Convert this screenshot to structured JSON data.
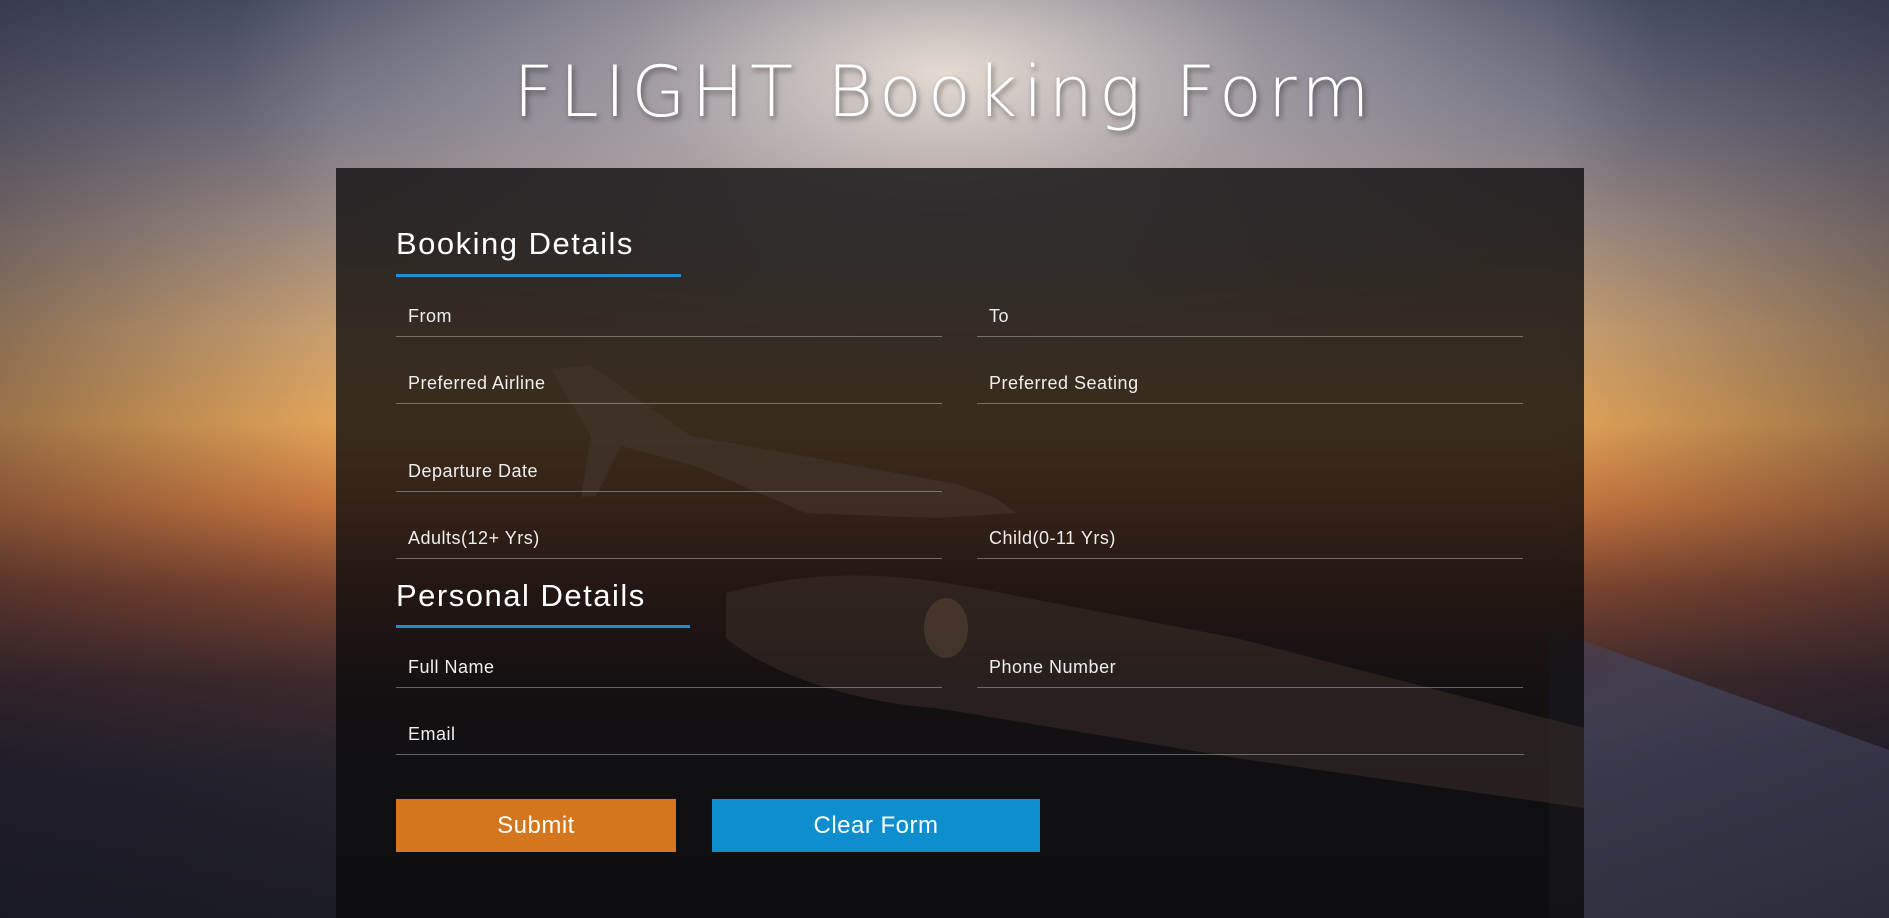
{
  "page": {
    "title": "FLIGHT Booking Form"
  },
  "booking": {
    "heading": "Booking Details",
    "from_placeholder": "From",
    "to_placeholder": "To",
    "airline_placeholder": "Preferred Airline",
    "seating_placeholder": "Preferred Seating",
    "departure_placeholder": "Departure Date",
    "adults_placeholder": "Adults(12+ Yrs)",
    "child_placeholder": "Child(0-11 Yrs)"
  },
  "personal": {
    "heading": "Personal Details",
    "name_placeholder": "Full Name",
    "phone_placeholder": "Phone Number",
    "email_placeholder": "Email"
  },
  "actions": {
    "submit_label": "Submit",
    "clear_label": "Clear Form"
  },
  "colors": {
    "accent_underline": "#1a8fd6",
    "submit_button": "#d4761e",
    "clear_button": "#0e8ecd",
    "panel": "rgba(10,10,12,0.78)"
  }
}
